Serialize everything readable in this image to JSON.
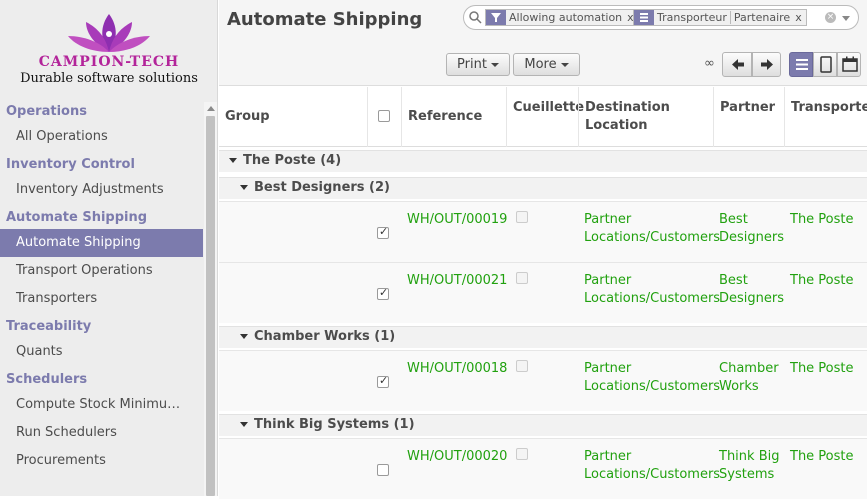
{
  "logo": {
    "brand": "CAMPION-TECH",
    "tagline": "Durable software solutions"
  },
  "menu": [
    {
      "section": "Operations",
      "items": [
        {
          "label": "All Operations"
        }
      ]
    },
    {
      "section": "Inventory Control",
      "items": [
        {
          "label": "Inventory Adjustments"
        }
      ]
    },
    {
      "section": "Automate Shipping",
      "items": [
        {
          "label": "Automate Shipping",
          "active": true
        },
        {
          "label": "Transport Operations"
        },
        {
          "label": "Transporters"
        }
      ]
    },
    {
      "section": "Traceability",
      "items": [
        {
          "label": "Quants"
        }
      ]
    },
    {
      "section": "Schedulers",
      "items": [
        {
          "label": "Compute Stock Minimu…"
        },
        {
          "label": "Run Schedulers"
        },
        {
          "label": "Procurements"
        }
      ]
    }
  ],
  "page": {
    "title": "Automate Shipping"
  },
  "search": {
    "filter_facet": "Allowing automation",
    "groupby_facet": [
      "Transporteur",
      "Partenaire"
    ],
    "remove_label": "x"
  },
  "buttons": {
    "print": "Print",
    "more": "More",
    "pager": "∞"
  },
  "colors": {
    "accent": "#7c7bad",
    "link_green": "#21a10f"
  },
  "columns": {
    "group": "Group",
    "reference": "Reference",
    "cueillette": "Cueillette",
    "destination": [
      "Destination",
      "Location"
    ],
    "partner": "Partner",
    "transporter": "Transporter"
  },
  "groups": {
    "top": {
      "label": "The Poste (4)"
    },
    "g1": {
      "label": "Best Designers (2)"
    },
    "g2": {
      "label": "Chamber Works (1)"
    },
    "g3": {
      "label": "Think Big Systems (1)"
    }
  },
  "rows": [
    {
      "checked": true,
      "reference": "WH/OUT/00019",
      "dest1": "Partner",
      "dest2": "Locations/Customers",
      "partner1": "Best",
      "partner2": "Designers",
      "transporter": "The Poste"
    },
    {
      "checked": true,
      "reference": "WH/OUT/00021",
      "dest1": "Partner",
      "dest2": "Locations/Customers",
      "partner1": "Best",
      "partner2": "Designers",
      "transporter": "The Poste"
    },
    {
      "checked": true,
      "reference": "WH/OUT/00018",
      "dest1": "Partner",
      "dest2": "Locations/Customers",
      "partner1": "Chamber",
      "partner2": "Works",
      "transporter": "The Poste"
    },
    {
      "checked": false,
      "reference": "WH/OUT/00020",
      "dest1": "Partner",
      "dest2": "Locations/Customers",
      "partner1": "Think Big",
      "partner2": "Systems",
      "transporter": "The Poste"
    }
  ]
}
